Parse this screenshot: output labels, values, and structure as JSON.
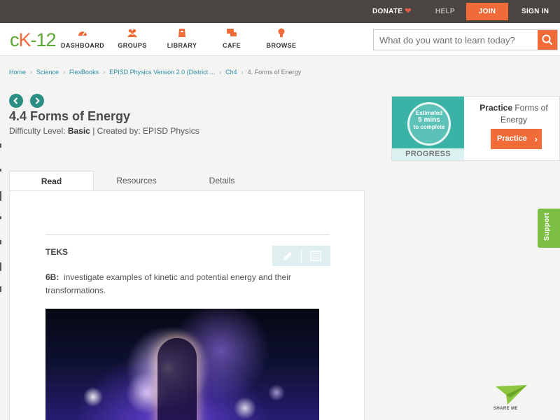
{
  "topbar": {
    "donate": "DONATE",
    "help": "HELP",
    "join": "JOIN",
    "signin": "SIGN IN"
  },
  "header": {
    "logo_left": "c",
    "logo_k": "K",
    "logo_right": "-12",
    "nav": [
      {
        "label": "DASHBOARD",
        "icon": "dashboard-icon"
      },
      {
        "label": "GROUPS",
        "icon": "groups-icon"
      },
      {
        "label": "LIBRARY",
        "icon": "library-icon"
      },
      {
        "label": "CAFE",
        "icon": "cafe-icon"
      },
      {
        "label": "BROWSE",
        "icon": "browse-icon"
      }
    ],
    "search_placeholder": "What do you want to learn today?"
  },
  "breadcrumb": [
    "Home",
    "Science",
    "FlexBooks",
    "EPISD Physics Version 2.0 (District ...",
    "Ch4",
    "4. Forms of Energy"
  ],
  "page": {
    "title": "4.4 Forms of Energy",
    "difficulty_label": "Difficulty Level:",
    "difficulty_value": "Basic",
    "created_by": "| Created by: EPISD Physics"
  },
  "practice": {
    "est_line1": "Estimated",
    "est_line2": "5 mins",
    "est_line3": "to complete",
    "progress_label": "PROGRESS",
    "heading_bold": "Practice",
    "heading_rest": "Forms of Energy",
    "button": "Practice"
  },
  "tabs": [
    "Read",
    "Resources",
    "Details"
  ],
  "content": {
    "section_title": "TEKS",
    "teks_code": "6B:",
    "teks_text": "investigate examples of kinetic and potential energy and their transformations."
  },
  "side": {
    "support": "Support",
    "share": "SHARE ME"
  },
  "colors": {
    "accent_orange": "#f16b38",
    "brand_green": "#5aa832",
    "teal": "#2a8e82",
    "link_teal": "#2a8fa6",
    "topbar": "#4a4540"
  }
}
